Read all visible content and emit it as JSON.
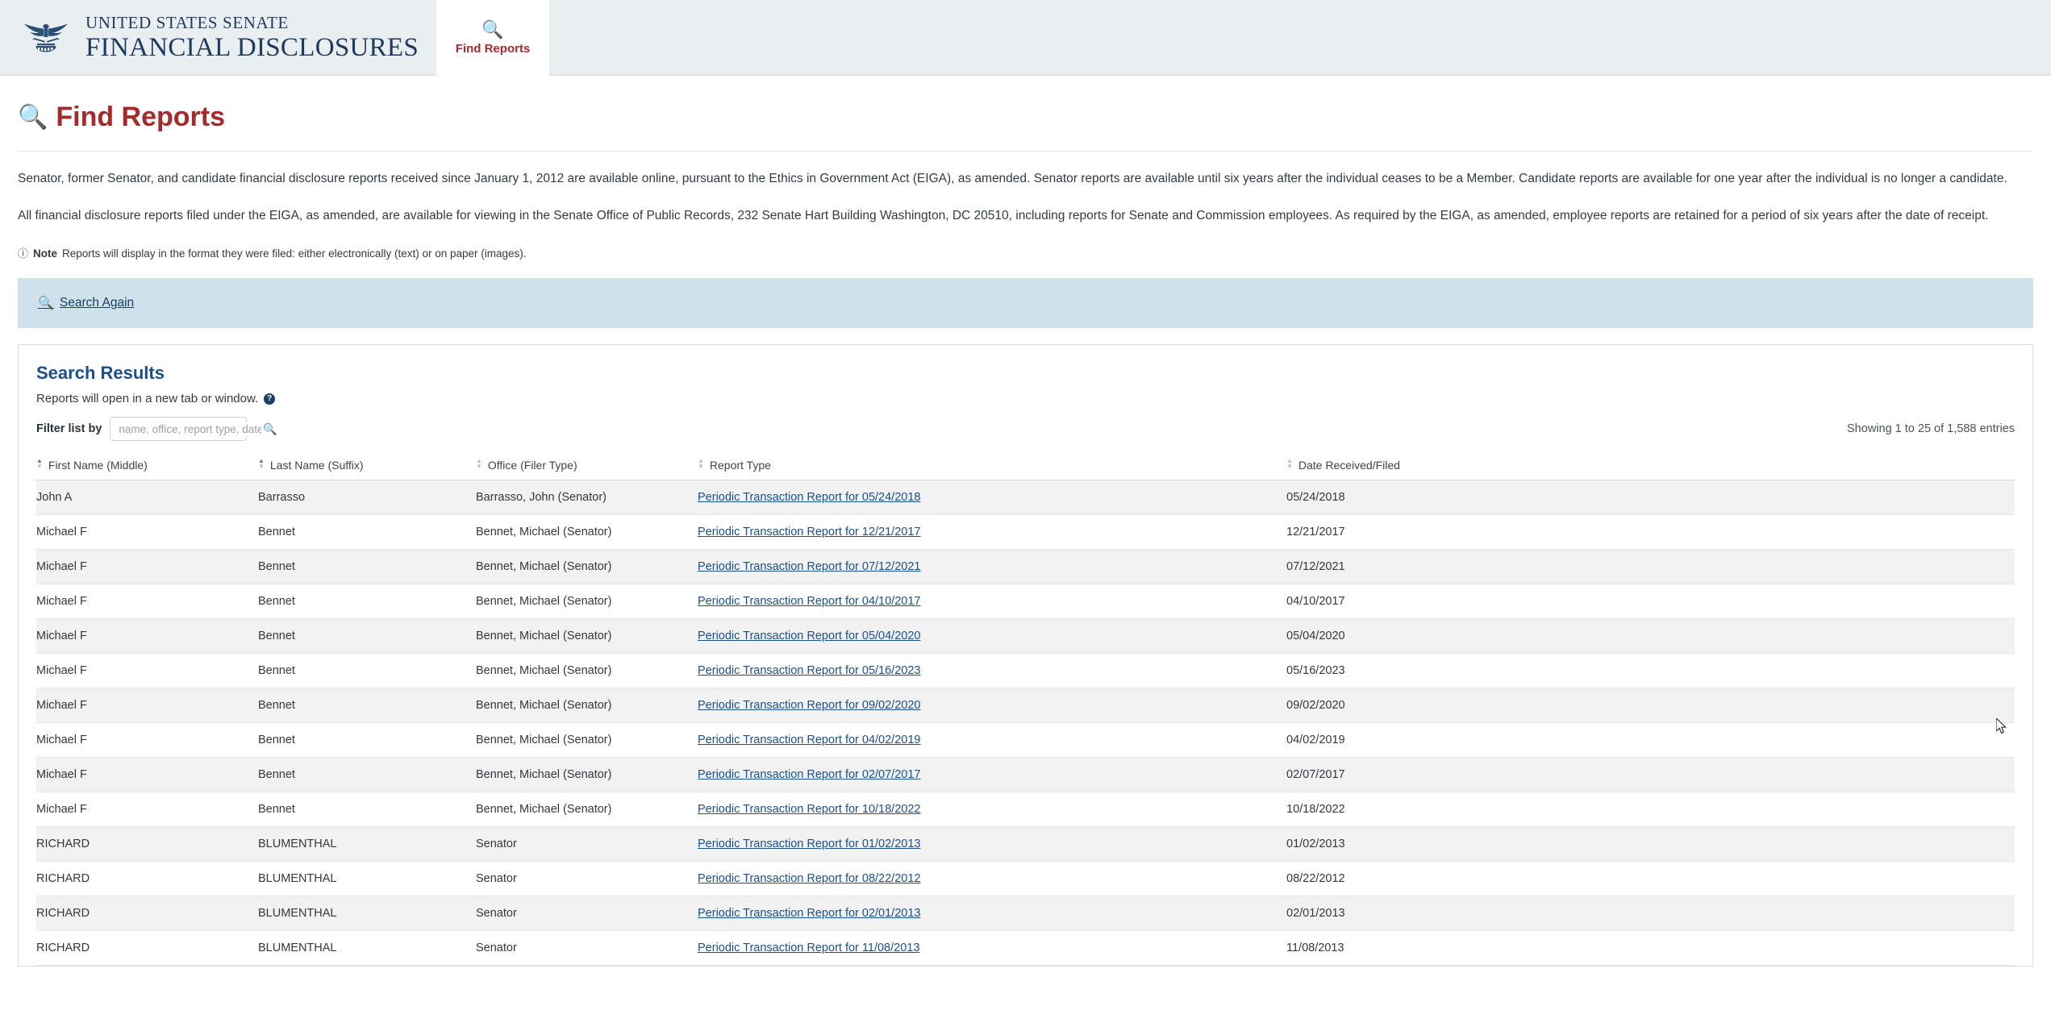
{
  "header": {
    "logo_line1": "UNITED STATES SENATE",
    "logo_line2": "FINANCIAL DISCLOSURES",
    "tab_icon": "search-icon",
    "tab_label": "Find Reports"
  },
  "page": {
    "title": "Find Reports",
    "title_icon": "search-icon",
    "paragraph1": "Senator, former Senator, and candidate financial disclosure reports received since January 1, 2012 are available online, pursuant to the Ethics in Government Act (EIGA), as amended. Senator reports are available until six years after the individual ceases to be a Member. Candidate reports are available for one year after the individual is no longer a candidate.",
    "paragraph2": "All financial disclosure reports filed under the EIGA, as amended, are available for viewing in the Senate Office of Public Records, 232 Senate Hart Building Washington, DC 20510, including reports for Senate and Commission employees. As required by the EIGA, as amended, employee reports are retained for a period of six years after the date of receipt.",
    "note_label": "Note",
    "note_text": "Reports will display in the format they were filed: either electronically (text) or on paper (images)."
  },
  "search_again": {
    "label": "Search Again",
    "icon": "search-icon"
  },
  "results": {
    "title": "Search Results",
    "subtitle": "Reports will open in a new tab or window.",
    "help_badge": "?",
    "filter_label": "Filter list by",
    "filter_value": "",
    "filter_placeholder": "name, office, report type, date",
    "filter_icon": "search-icon",
    "showing_entries": "Showing 1 to 25 of 1,588 entries",
    "columns": [
      "First Name (Middle)",
      "Last Name (Suffix)",
      "Office (Filer Type)",
      "Report Type",
      "Date Received/Filed"
    ],
    "rows": [
      {
        "first_name": "John A",
        "last_name": "Barrasso",
        "office": "Barrasso, John (Senator)",
        "report_type": "Periodic Transaction Report for 05/24/2018",
        "date": "05/24/2018"
      },
      {
        "first_name": "Michael F",
        "last_name": "Bennet",
        "office": "Bennet, Michael (Senator)",
        "report_type": "Periodic Transaction Report for 12/21/2017",
        "date": "12/21/2017"
      },
      {
        "first_name": "Michael F",
        "last_name": "Bennet",
        "office": "Bennet, Michael (Senator)",
        "report_type": "Periodic Transaction Report for 07/12/2021",
        "date": "07/12/2021"
      },
      {
        "first_name": "Michael F",
        "last_name": "Bennet",
        "office": "Bennet, Michael (Senator)",
        "report_type": "Periodic Transaction Report for 04/10/2017",
        "date": "04/10/2017"
      },
      {
        "first_name": "Michael F",
        "last_name": "Bennet",
        "office": "Bennet, Michael (Senator)",
        "report_type": "Periodic Transaction Report for 05/04/2020",
        "date": "05/04/2020"
      },
      {
        "first_name": "Michael F",
        "last_name": "Bennet",
        "office": "Bennet, Michael (Senator)",
        "report_type": "Periodic Transaction Report for 05/16/2023",
        "date": "05/16/2023"
      },
      {
        "first_name": "Michael F",
        "last_name": "Bennet",
        "office": "Bennet, Michael (Senator)",
        "report_type": "Periodic Transaction Report for 09/02/2020",
        "date": "09/02/2020"
      },
      {
        "first_name": "Michael F",
        "last_name": "Bennet",
        "office": "Bennet, Michael (Senator)",
        "report_type": "Periodic Transaction Report for 04/02/2019",
        "date": "04/02/2019"
      },
      {
        "first_name": "Michael F",
        "last_name": "Bennet",
        "office": "Bennet, Michael (Senator)",
        "report_type": "Periodic Transaction Report for 02/07/2017",
        "date": "02/07/2017"
      },
      {
        "first_name": "Michael F",
        "last_name": "Bennet",
        "office": "Bennet, Michael (Senator)",
        "report_type": "Periodic Transaction Report for 10/18/2022",
        "date": "10/18/2022"
      },
      {
        "first_name": "RICHARD",
        "last_name": "BLUMENTHAL",
        "office": "Senator",
        "report_type": "Periodic Transaction Report for 01/02/2013",
        "date": "01/02/2013"
      },
      {
        "first_name": "RICHARD",
        "last_name": "BLUMENTHAL",
        "office": "Senator",
        "report_type": "Periodic Transaction Report for 08/22/2012",
        "date": "08/22/2012"
      },
      {
        "first_name": "RICHARD",
        "last_name": "BLUMENTHAL",
        "office": "Senator",
        "report_type": "Periodic Transaction Report for 02/01/2013",
        "date": "02/01/2013"
      },
      {
        "first_name": "RICHARD",
        "last_name": "BLUMENTHAL",
        "office": "Senator",
        "report_type": "Periodic Transaction Report for 11/08/2013",
        "date": "11/08/2013"
      }
    ]
  },
  "colors": {
    "brand_navy": "#1f3a5f",
    "accent_red": "#a32b2b",
    "link_blue": "#1b4f8a",
    "banner_blue": "#cfe2ec",
    "topbar_gray": "#e9eef1"
  }
}
